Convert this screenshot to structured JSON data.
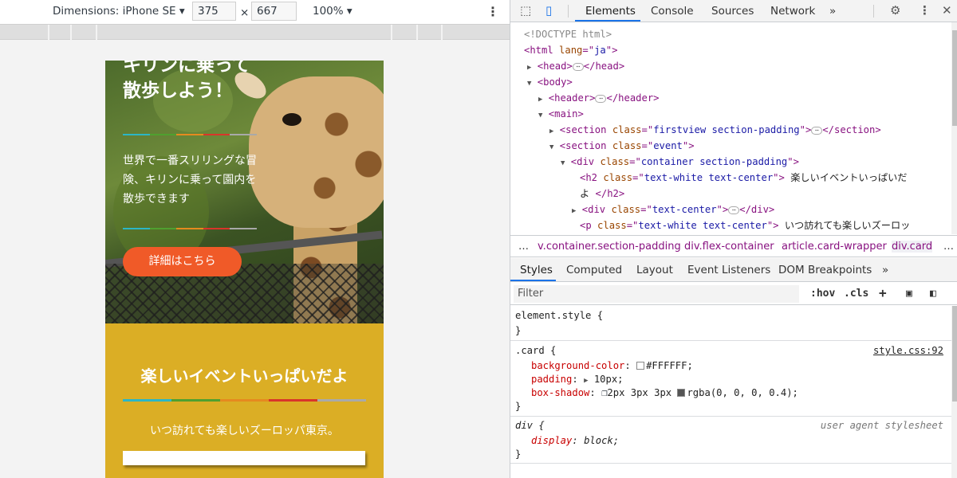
{
  "device_toolbar": {
    "dimensions_label": "Dimensions: iPhone SE",
    "width_value": "375",
    "times_symbol": "×",
    "height_value": "667",
    "zoom_label": "100%"
  },
  "phone": {
    "hero_title_partial": "キリンに乗って",
    "hero_title_line2": "散歩しよう！",
    "hero_text": "世界で一番スリリングな冒険、キリンに乗って園内を散歩できます",
    "hero_button": "詳細はこちら",
    "event_title": "楽しいイベントいっぱいだよ",
    "event_text": "いつ訪れても楽しいズーロッパ東京。",
    "rule_colors": [
      "#2bb6c6",
      "#4fa02f",
      "#e58a1f",
      "#d9352a",
      "#a9a9a9"
    ],
    "event_bg": "#dbae25",
    "button_color": "#f05a28"
  },
  "devtools": {
    "tabs": [
      "Elements",
      "Console",
      "Sources",
      "Network"
    ],
    "active_tab": "Elements",
    "more_tabs_icon": "»",
    "dom": {
      "doctype": "<!DOCTYPE html>",
      "html_lang": "ja",
      "header_tag": "header",
      "main_tag": "main",
      "section1_class": "firstview section-padding",
      "section2_class": "event",
      "div_class": "container section-padding",
      "h2_class": "text-white text-center",
      "h2_text_line1": "楽しいイベントいっぱいだ",
      "h2_text_line2": "よ ",
      "div2_class": "text-center",
      "p_class": "text-white text-center",
      "p_text": "いつ訪れても楽しいズーロッ"
    },
    "breadcrumbs": [
      "…",
      "v.container.section-padding",
      "div.flex-container",
      "article.card-wrapper",
      "div.card",
      "…"
    ],
    "subtabs": [
      "Styles",
      "Computed",
      "Layout",
      "Event Listeners",
      "DOM Breakpoints",
      "»"
    ],
    "filter_placeholder": "Filter",
    "filter_hov": ":hov",
    "filter_cls": ".cls",
    "filter_plus": "+",
    "styles": {
      "element_style": "element.style {",
      "card_selector": ".card {",
      "card_source": "style.css:92",
      "bg_prop": "background-color",
      "bg_val": "#FFFFFF;",
      "padding_prop": "padding",
      "padding_val": "10px;",
      "shadow_prop": "box-shadow",
      "shadow_val_1": "2px 3px 3px",
      "shadow_val_2": "rgba(0, 0, 0, 0.4);",
      "div_selector": "div {",
      "ua_label": "user agent stylesheet",
      "display_prop": "display",
      "display_val": "block;",
      "close_brace": "}"
    }
  }
}
